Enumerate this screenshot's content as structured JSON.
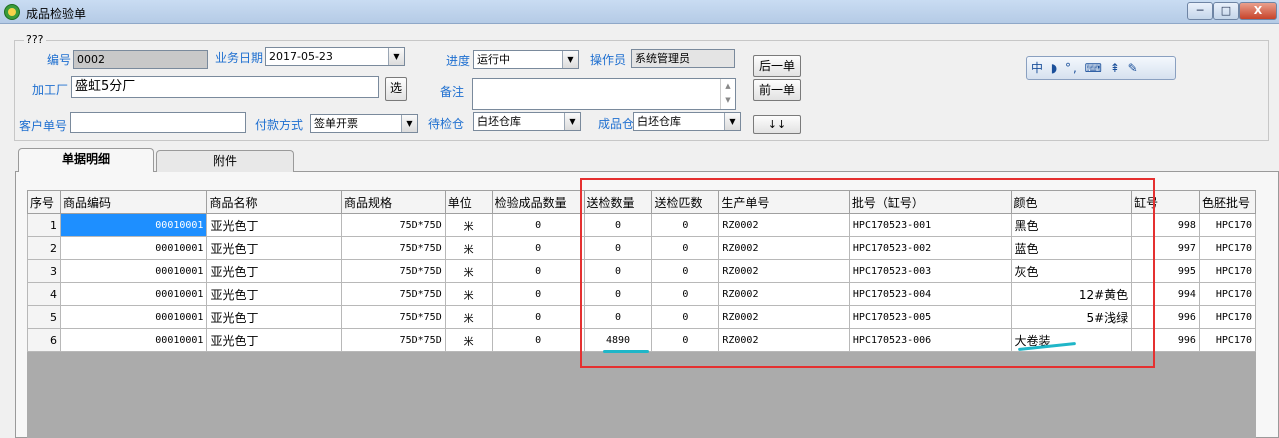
{
  "window": {
    "title": "成品检验单",
    "min": "─",
    "max": "□",
    "close": "X"
  },
  "group": {
    "label": "???"
  },
  "form": {
    "bill_no_label": "编号",
    "bill_no": "0002",
    "biz_date_label": "业务日期",
    "biz_date": "2017-05-23",
    "progress_label": "进度",
    "progress": "运行中",
    "operator_label": "操作员",
    "operator": "系统管理员",
    "factory_label": "加工厂",
    "factory": "盛虹5分厂",
    "select_btn": "选",
    "remark_label": "备注",
    "remark": "",
    "customer_no_label": "客户单号",
    "customer_no": "",
    "payment_label": "付款方式",
    "payment": "签单开票",
    "pending_wh_label": "待检仓",
    "pending_wh": "白坯仓库",
    "finished_wh_label": "成品仓",
    "finished_wh": "白坯仓库"
  },
  "buttons": {
    "next": "后一单",
    "prev": "前一单",
    "down": "↓↓"
  },
  "ime_toolbar": {
    "text": "中 ◗ °, ⌨ ⇞ ✎"
  },
  "tabs": [
    {
      "label": "单据明细"
    },
    {
      "label": "附件"
    }
  ],
  "table": {
    "headers": [
      "序号",
      "商品编码",
      "商品名称",
      "商品规格",
      "单位",
      "检验成品数量",
      "送检数量",
      "送检匹数",
      "生产单号",
      "批号（缸号）",
      "颜色",
      "缸号",
      "色胚批号"
    ],
    "rows": [
      [
        "1",
        "00010001",
        "亚光色丁",
        "75D*75D",
        "米",
        "0",
        "0",
        "0",
        "RZ0002",
        "HPC170523-001",
        "黑色",
        "998",
        "HPC170"
      ],
      [
        "2",
        "00010001",
        "亚光色丁",
        "75D*75D",
        "米",
        "0",
        "0",
        "0",
        "RZ0002",
        "HPC170523-002",
        "蓝色",
        "997",
        "HPC170"
      ],
      [
        "3",
        "00010001",
        "亚光色丁",
        "75D*75D",
        "米",
        "0",
        "0",
        "0",
        "RZ0002",
        "HPC170523-003",
        "灰色",
        "995",
        "HPC170"
      ],
      [
        "4",
        "00010001",
        "亚光色丁",
        "75D*75D",
        "米",
        "0",
        "0",
        "0",
        "RZ0002",
        "HPC170523-004",
        "12#黄色",
        "994",
        "HPC170"
      ],
      [
        "5",
        "00010001",
        "亚光色丁",
        "75D*75D",
        "米",
        "0",
        "0",
        "0",
        "RZ0002",
        "HPC170523-005",
        "5#浅绿",
        "996",
        "HPC170"
      ],
      [
        "6",
        "00010001",
        "亚光色丁",
        "75D*75D",
        "米",
        "0",
        "4890",
        "0",
        "RZ0002",
        "HPC170523-006",
        "大卷装",
        "996",
        "HPC170"
      ]
    ]
  },
  "colors": {
    "annotation_box": "#e53030",
    "annotation_underline": "#1fb6c8",
    "selection": "#1e8fff"
  }
}
